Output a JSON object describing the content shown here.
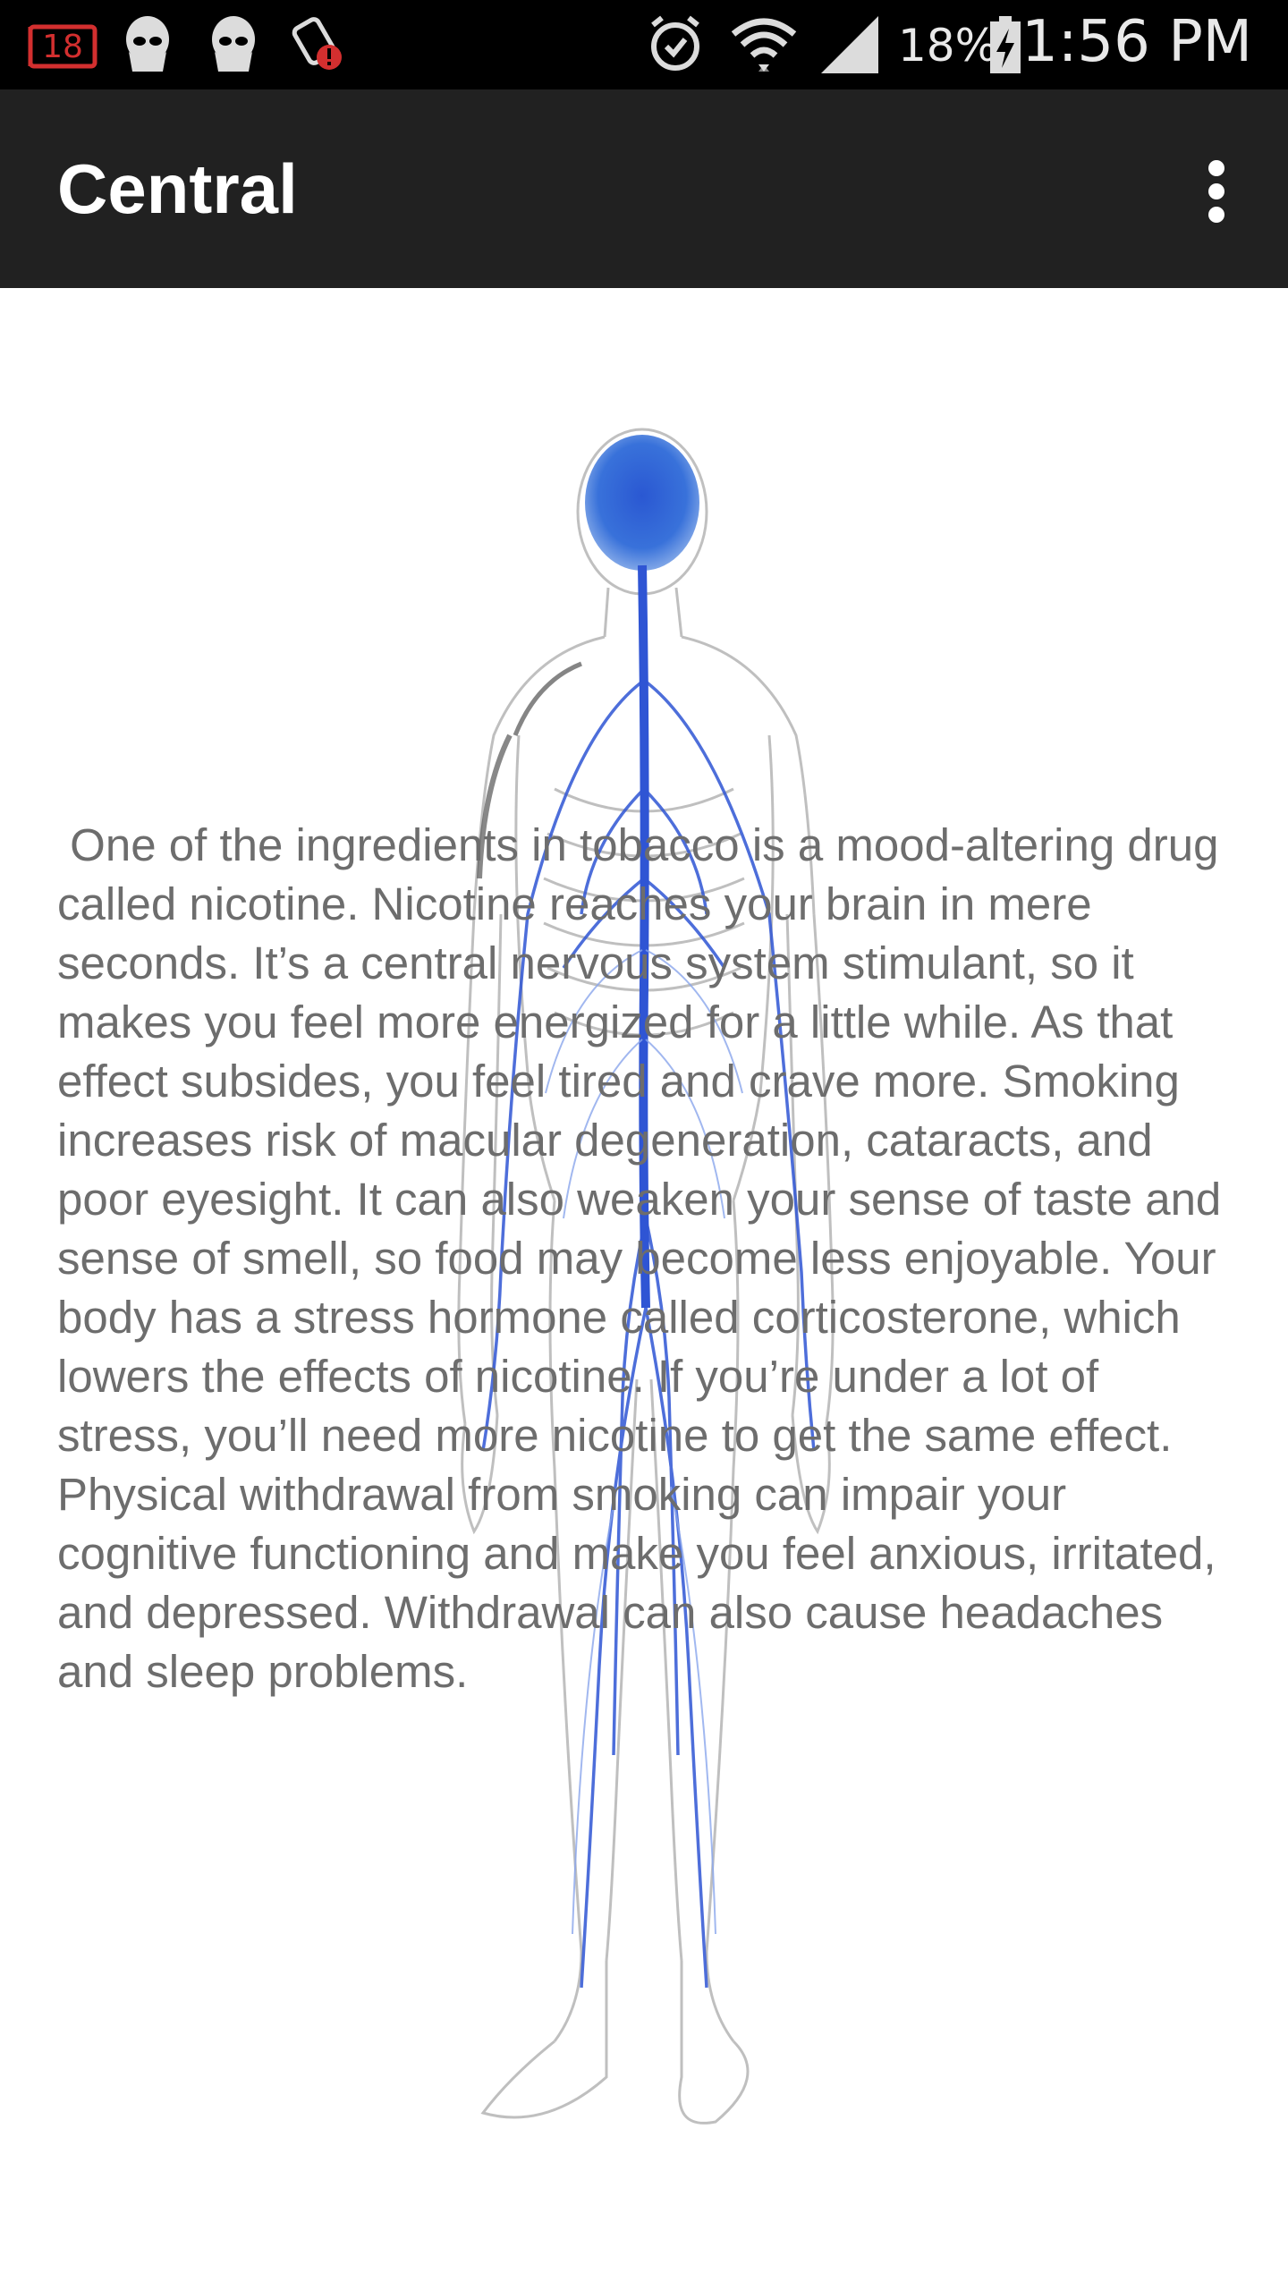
{
  "status_bar": {
    "notification_badge": "18",
    "battery_percent": "18%",
    "time": "1:56 PM"
  },
  "app_bar": {
    "title": "Central"
  },
  "content": {
    "body_text": " One of the ingredients in tobacco is a mood-altering drug called nicotine. Nicotine reaches your brain in mere seconds. It’s a central nervous system stimulant, so it makes you feel more energized for a little while. As that effect subsides, you feel tired and crave more. Smoking increases risk of macular degeneration, cataracts, and poor eyesight. It can also weaken your sense of taste and sense of smell, so food may become less enjoyable. Your body has a stress hormone called corticosterone, which lowers the effects of nicotine. If you’re under a lot of stress, you’ll need more nicotine to get the same effect. Physical withdrawal from smoking can impair your cognitive functioning and make you feel anxious, irritated, and depressed. Withdrawal can also cause headaches and sleep problems."
  },
  "colors": {
    "status_bar": "#000000",
    "app_bar": "#212121",
    "body_text": "#6d6d6d",
    "nerve_blue": "#2f55d4",
    "badge_red": "#d32f2f"
  },
  "icons": [
    "calendar-badge-icon",
    "alien-icon",
    "alien-icon",
    "app-alert-icon",
    "alarm-icon",
    "wifi-icon",
    "signal-icon",
    "battery-charging-icon",
    "more-vert-icon"
  ]
}
